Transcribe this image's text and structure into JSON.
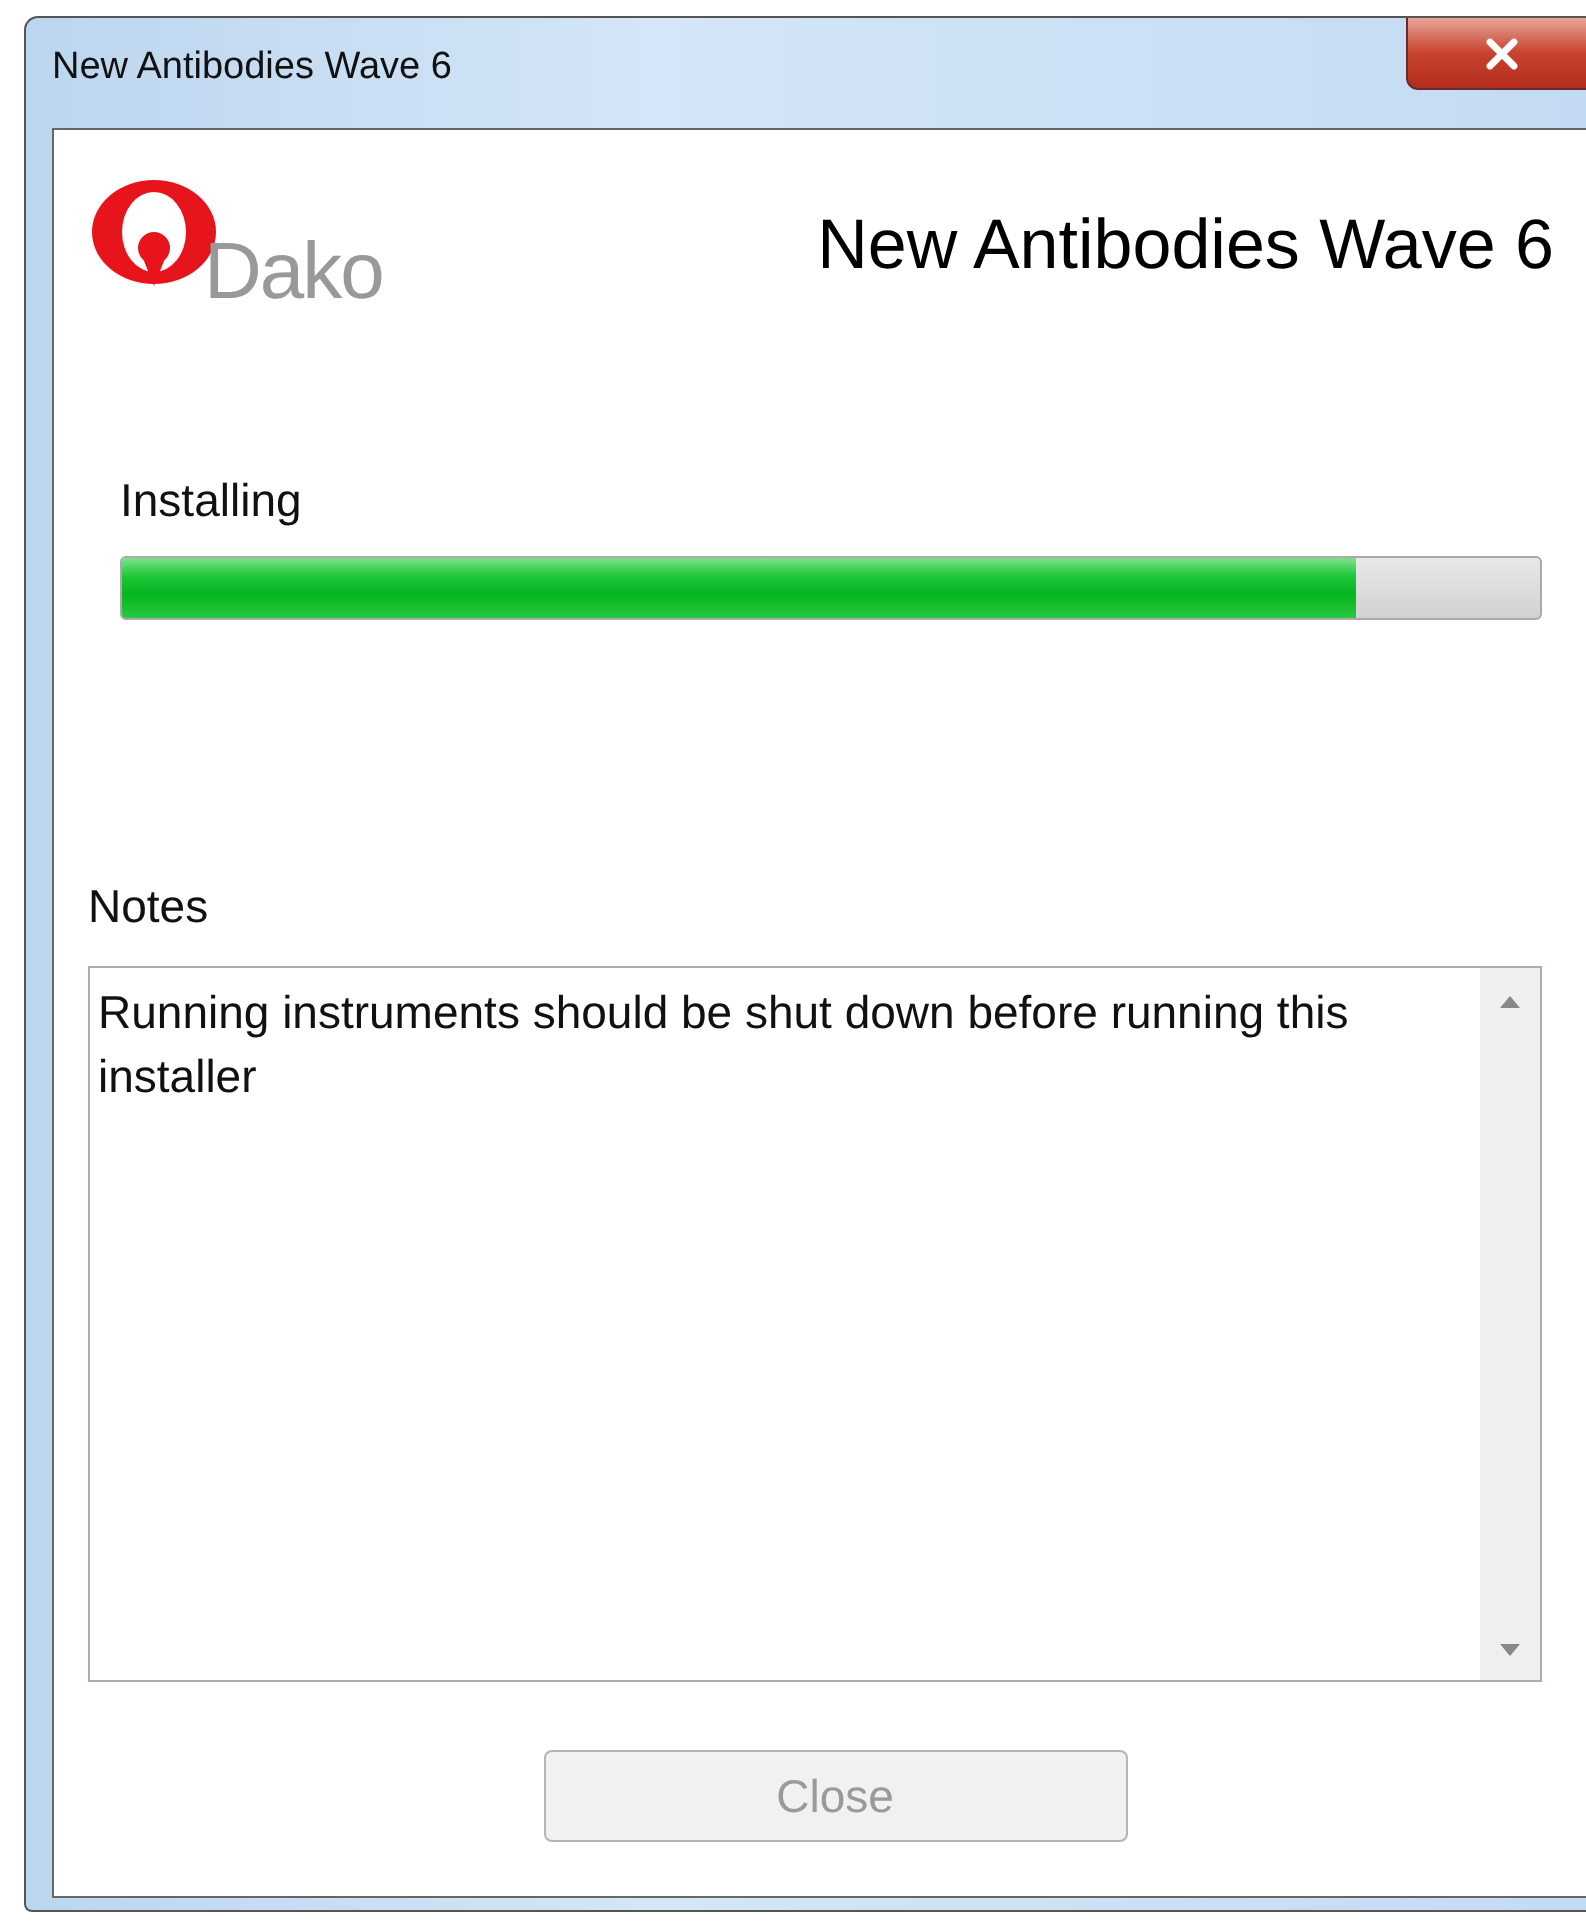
{
  "window": {
    "title": "New Antibodies Wave 6"
  },
  "header": {
    "logo_text": "Dako",
    "title": "New Antibodies Wave 6"
  },
  "progress": {
    "label": "Installing",
    "level": 0.87
  },
  "notes": {
    "label": "Notes",
    "text": "Running instruments should be shut down before running this installer"
  },
  "buttons": [
    {
      "label": "Close",
      "disabled": true
    }
  ]
}
